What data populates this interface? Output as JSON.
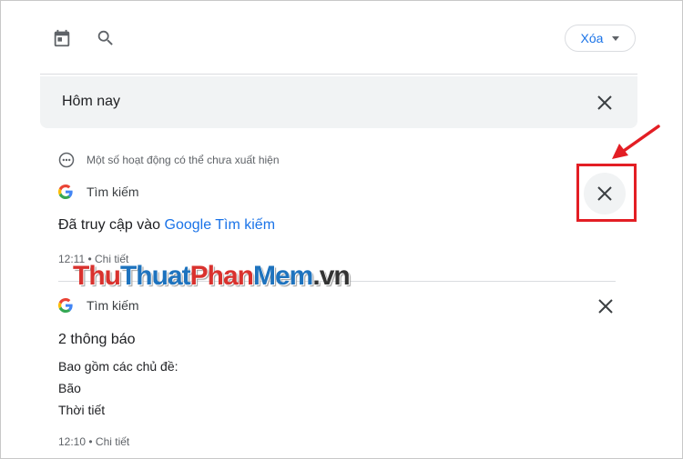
{
  "toolbar": {
    "calendar_icon": "calendar-icon",
    "search_icon": "search-icon",
    "delete_label": "Xóa"
  },
  "today": {
    "title": "Hôm nay"
  },
  "notice": {
    "text": "Một số hoạt động có thể chưa xuất hiện"
  },
  "entries": [
    {
      "source": "Tìm kiếm",
      "title_prefix": "Đã truy cập vào ",
      "title_link": "Google Tìm kiếm",
      "meta": "12:11 • Chi tiết"
    },
    {
      "source": "Tìm kiếm",
      "title": "2 thông báo",
      "lines": [
        "Bao gồm các chủ đề:",
        "Bão",
        "Thời tiết"
      ],
      "meta": "12:10 • Chi tiết"
    }
  ],
  "watermark": {
    "part1": "Thu",
    "part2": "Thuat",
    "part3": "Phan",
    "part4": "Mem",
    "part5": ".vn"
  },
  "colors": {
    "accent": "#1a73e8",
    "highlight": "#e31e24"
  }
}
